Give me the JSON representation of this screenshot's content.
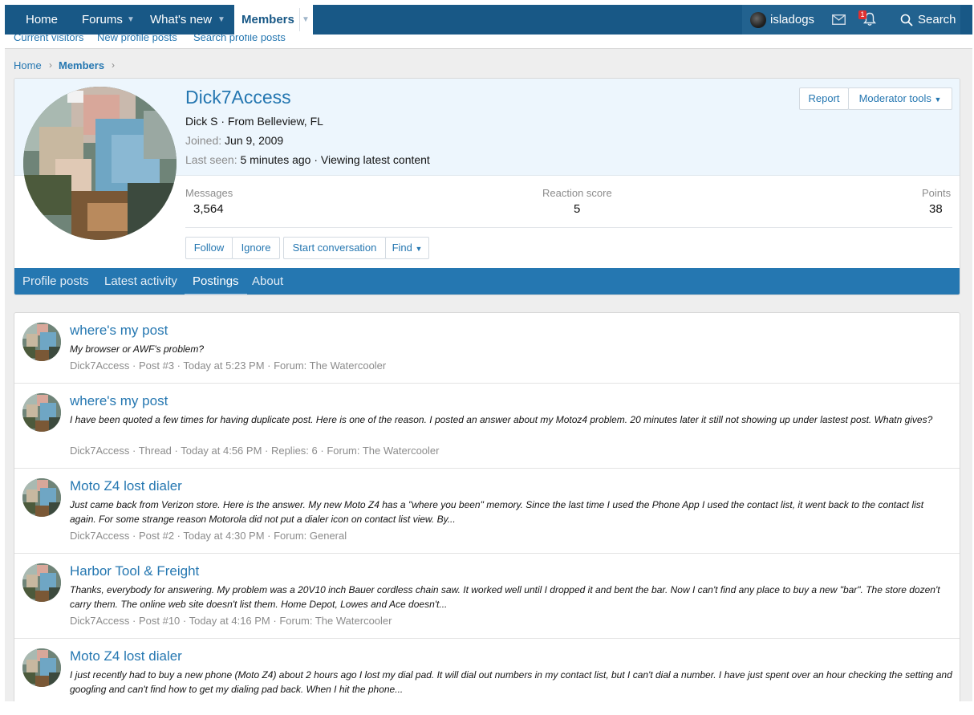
{
  "topnav": {
    "items": [
      "Home",
      "Forums",
      "What's new"
    ],
    "active": "Members",
    "username": "isladogs",
    "alert_count": "1",
    "search_label": "Search"
  },
  "subnav": [
    "Current visitors",
    "New profile posts",
    "Search profile posts"
  ],
  "breadcrumb": [
    "Home",
    "Members"
  ],
  "profile": {
    "name": "Dick7Access",
    "line1": "Dick S · From Belleview, FL",
    "joined_label": "Joined:",
    "joined_value": "Jun 9, 2009",
    "lastseen_label": "Last seen:",
    "lastseen_value": "5 minutes ago · Viewing latest content",
    "report": "Report",
    "moderator_tools": "Moderator tools",
    "stats": {
      "messages_label": "Messages",
      "messages_value": "3,564",
      "reaction_label": "Reaction score",
      "reaction_value": "5",
      "points_label": "Points",
      "points_value": "38"
    },
    "buttons": [
      "Follow",
      "Ignore",
      "Start conversation",
      "Find"
    ],
    "tabs": [
      "Profile posts",
      "Latest activity",
      "Postings",
      "About"
    ]
  },
  "posts": [
    {
      "title": "where's my post",
      "snippet": "My browser or AWF's problem?",
      "meta": "Dick7Access · Post #3 · Today at 5:23 PM · Forum: The Watercooler"
    },
    {
      "title": "where's my post",
      "snippet": "I have been quoted a few times for having duplicate post. Here is one of the reason. I posted an answer about my Motoz4 problem. 20 minutes later it still not showing up under lastest post. Whatn gives?",
      "meta": "Dick7Access · Thread · Today at 4:56 PM · Replies: 6 · Forum: The Watercooler"
    },
    {
      "title": "Moto Z4 lost dialer",
      "snippet": "Just came back from Verizon store. Here is the answer. My new Moto Z4 has a \"where you been\" memory. Since the last time I used the Phone App I used the contact list, it went back to the contact list again. For some strange reason Motorola did not put a dialer icon on contact list view. By...",
      "meta": "Dick7Access · Post #2 · Today at 4:30 PM · Forum: General"
    },
    {
      "title": "Harbor Tool & Freight",
      "snippet": "Thanks, everybody for answering. My problem was a 20V10 inch Bauer cordless chain saw. It worked well until I dropped it and bent the bar. Now I can't find any place to buy a new \"bar\". The store dozen't carry them. The online web site doesn't list them. Home Depot, Lowes and Ace doesn't...",
      "meta": "Dick7Access · Post #10 · Today at 4:16 PM · Forum: The Watercooler"
    },
    {
      "title": "Moto Z4 lost dialer",
      "snippet": "I just recently had to buy a new phone (Moto Z4) about 2 hours ago I lost my dial pad. It will dial out numbers in my contact list, but I can't dial a number. I have just spent over an hour checking the setting and googling and can't find how to get my dialing pad back. When I hit the phone...",
      "meta": ""
    }
  ]
}
